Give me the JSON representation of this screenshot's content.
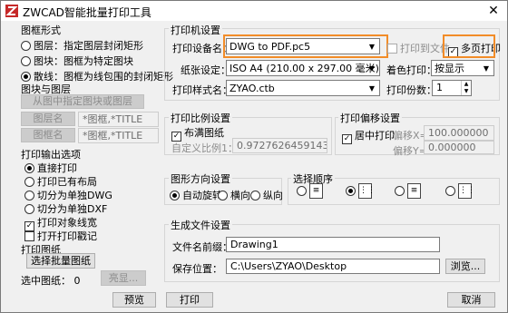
{
  "window": {
    "title": "ZWCAD智能批量打印工具",
    "close_symbol": "✕"
  },
  "layout_form": {
    "title": "图框形式",
    "options": [
      "图层：指定图层封闭矩形",
      "图块：图框为特定图块",
      "散线：图框为线包围的封闭矩形"
    ],
    "selected": 2
  },
  "block_layer": {
    "title": "图块与图层",
    "pick_button": "从图中指定图块或图层",
    "block_name_btn": "图层名",
    "block_name_value": "*图框,*TITLE",
    "layer_name_btn": "图框名",
    "layer_name_value": "*图框,*TITLE"
  },
  "output": {
    "title": "打印输出选项",
    "options": [
      "直接打印",
      "打印已有布局",
      "切分为单独DWG",
      "切分为单独DXF"
    ],
    "selected": 0,
    "checks": [
      {
        "label": "打印对象线宽",
        "checked": true
      },
      {
        "label": "打开打印戳记",
        "checked": false
      }
    ]
  },
  "paper": {
    "title": "打印图纸",
    "select_button": "选择批量图纸",
    "selected_label": "选中图纸：",
    "selected_count": "0",
    "highlight_button": "亮显..."
  },
  "printer": {
    "title": "打印机设置",
    "device_label": "打印设备名：",
    "device_value": "DWG to PDF.pc5",
    "print_to_file": "打印到文件",
    "multi_page": "多页打印",
    "paper_label": "纸张设定：",
    "paper_value": "ISO A4 (210.00 x 297.00 毫米)",
    "color_label": "着色打印：",
    "color_value": "按显示",
    "style_label": "打印样式名：",
    "style_value": "ZYAO.ctb",
    "copies_label": "打印份数：",
    "copies_value": "1"
  },
  "scale": {
    "title": "打印比例设置",
    "fit_label": "布满图纸",
    "custom_label": "自定义比例1：",
    "custom_value": "0.972762645914396"
  },
  "offset": {
    "title": "打印偏移设置",
    "center_label": "居中打印",
    "x_label": "偏移X=",
    "x_value": "100.000000",
    "y_label": "偏移Y=",
    "y_value": "0.000000"
  },
  "orientation": {
    "title": "图形方向设置",
    "options": [
      "自动旋转",
      "横向",
      "纵向"
    ],
    "selected": 0
  },
  "order": {
    "title": "选择顺序",
    "selected": 1,
    "count": 4
  },
  "file": {
    "title": "生成文件设置",
    "prefix_label": "文件名前缀：",
    "prefix_value": "Drawing1",
    "path_label": "保存位置：",
    "path_value": "C:\\Users\\ZYAO\\Desktop",
    "browse": "浏览..."
  },
  "bottom": {
    "preview": "预览",
    "print": "打印",
    "cancel": "取消"
  },
  "colors": {
    "highlight": "#f28c28",
    "title_bg": "#ffffff",
    "dialog_bg": "#f0f0f0"
  }
}
